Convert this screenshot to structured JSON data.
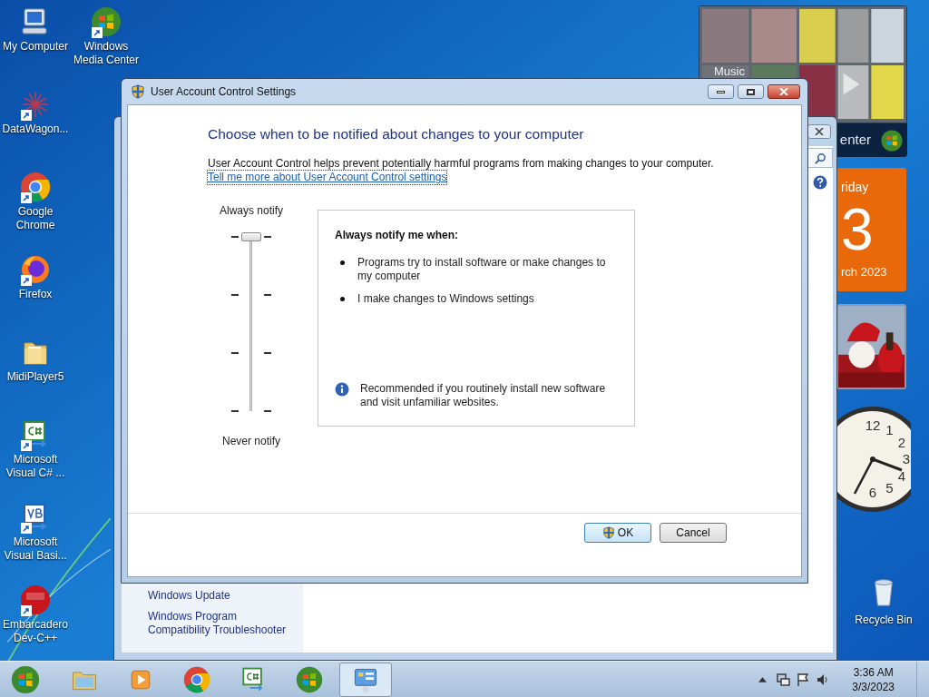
{
  "desktop_icons": [
    {
      "label": "My Computer",
      "kind": "computer"
    },
    {
      "label": "DataWagon...",
      "kind": "sparkle"
    },
    {
      "label": "Google Chrome",
      "kind": "chrome"
    },
    {
      "label": "Firefox",
      "kind": "firefox"
    },
    {
      "label": "MidiPlayer5",
      "kind": "folder"
    },
    {
      "label": "Microsoft Visual C# ...",
      "kind": "csharp"
    },
    {
      "label": "Microsoft Visual Basi...",
      "kind": "vb"
    },
    {
      "label": "Embarcadero Dev-C++",
      "kind": "dev"
    }
  ],
  "desktop_icons_right": [
    {
      "label": "Windows Media Center",
      "kind": "windows"
    }
  ],
  "recycle_bin": {
    "label": "Recycle Bin"
  },
  "gadgets": {
    "media_center": {
      "label": "Music",
      "brand": "enter"
    },
    "calendar": {
      "weekday": "riday",
      "day": "3",
      "month_year": "rch 2023"
    },
    "clock": {
      "numerals": [
        "12",
        "1",
        "2",
        "3",
        "4",
        "5",
        "6"
      ]
    }
  },
  "background_window": {
    "sidebar_items": [
      "Windows Update",
      "Windows Program Compatibility Troubleshooter"
    ]
  },
  "dialog": {
    "title": "User Account Control Settings",
    "heading": "Choose when to be notified about changes to your computer",
    "description": "User Account Control helps prevent potentially harmful programs from making changes to your computer.",
    "link": "Tell me more about User Account Control settings",
    "slider": {
      "top_label": "Always notify",
      "bottom_label": "Never notify",
      "level": 1
    },
    "panel": {
      "title": "Always notify me when:",
      "bullets": [
        "Programs try to install software or make changes to my computer",
        "I make changes to Windows settings"
      ],
      "note": "Recommended if you routinely install new software and visit unfamiliar websites."
    },
    "buttons": [
      {
        "label": "OK",
        "kind": "shield"
      },
      {
        "label": "Cancel",
        "kind": "plain"
      }
    ]
  },
  "taskbar": {
    "apps": [
      {
        "kind": "explorer",
        "selected": false
      },
      {
        "kind": "player",
        "selected": false
      },
      {
        "kind": "chrome",
        "selected": false
      },
      {
        "kind": "csharp",
        "selected": false
      },
      {
        "kind": "windows",
        "selected": false
      },
      {
        "kind": "control",
        "selected": true
      }
    ],
    "time": "3:36 AM",
    "date": "3/3/2023"
  }
}
